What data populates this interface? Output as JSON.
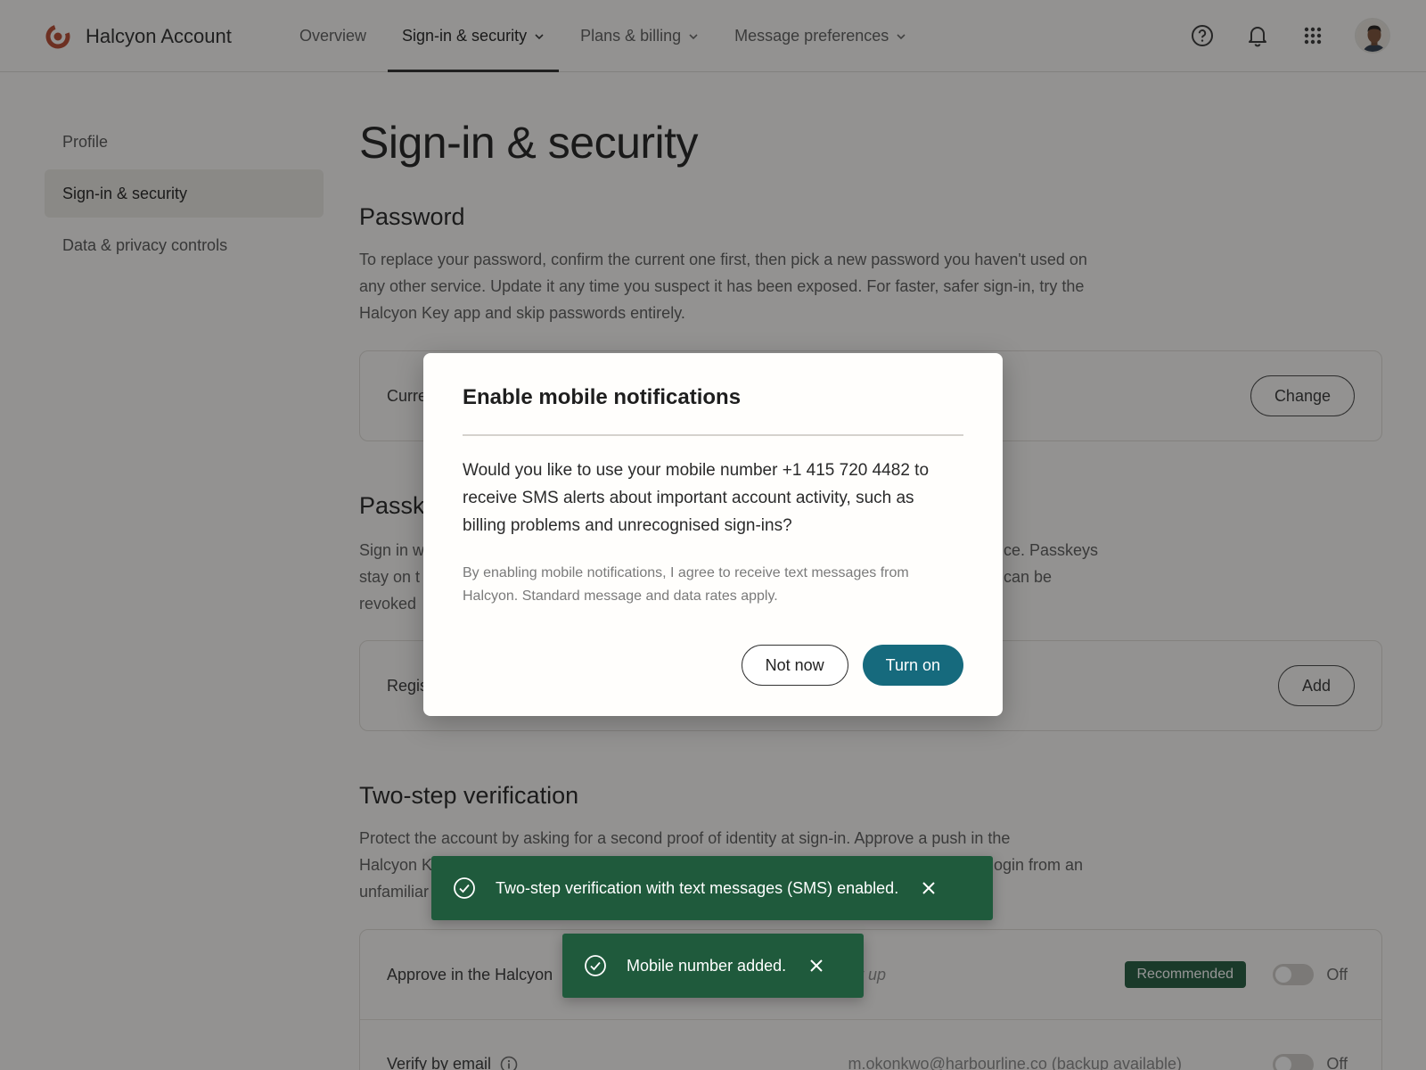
{
  "app": {
    "name": "Halcyon Account"
  },
  "nav": {
    "items": [
      {
        "label": "Overview",
        "active": false,
        "dropdown": false
      },
      {
        "label": "Sign-in & security",
        "active": true,
        "dropdown": true
      },
      {
        "label": "Plans & billing",
        "active": false,
        "dropdown": true
      },
      {
        "label": "Message preferences",
        "active": false,
        "dropdown": true
      }
    ]
  },
  "top_icons": [
    "help-icon",
    "bell-icon",
    "apps-grid-icon",
    "avatar"
  ],
  "sidebar": {
    "items": [
      {
        "label": "Profile",
        "active": false
      },
      {
        "label": "Sign-in & security",
        "active": true
      },
      {
        "label": "Data & privacy controls",
        "active": false
      }
    ]
  },
  "page": {
    "title": "Sign-in & security"
  },
  "password": {
    "title": "Password",
    "description": "To replace your password, confirm the current one first, then pick a new password you haven't used on any other service. Update it any time you suspect it has been exposed. For faster, safer sign-in, try the Halcyon Key app and skip passwords entirely.",
    "row_label": "Curre",
    "button": "Change"
  },
  "passkeys": {
    "title": "Passke",
    "desc_line1_left": "Sign in w",
    "desc_line1_right": "ce. Passkeys",
    "desc_line2_left": "stay on t",
    "desc_line2_right": "can be",
    "desc_line3_left": "revoked",
    "row_label": "Regis",
    "button": "Add"
  },
  "two_step": {
    "title": "Two-step verification",
    "desc_line1": "Protect the account by asking for a second proof of identity at sign-in. Approve a push in the",
    "desc_line2_left": "Halcyon K",
    "desc_line2_right": "ogin from an",
    "desc_line3_left": "unfamiliar",
    "rows": [
      {
        "label": "Approve in the Halcyon",
        "status": "et up",
        "badge": "Recommended",
        "toggle": "Off"
      },
      {
        "label": "Verify by email",
        "detail": "m.okonkwo@harbourline.co (backup available)",
        "toggle": "Off"
      }
    ]
  },
  "modal": {
    "title": "Enable mobile notifications",
    "body": "Would you like to use your mobile number +1 415 720 4482 to receive SMS alerts about important account activity, such as billing problems and unrecognised sign-ins?",
    "note": "By enabling mobile notifications, I agree to receive text messages from Halcyon. Standard message and data rates apply.",
    "secondary": "Not now",
    "primary": "Turn on"
  },
  "toasts": [
    {
      "message": "Two-step verification with text messages (SMS) enabled."
    },
    {
      "message": "Mobile number added."
    }
  ],
  "colors": {
    "accent": "#166a7d",
    "success": "#1f5a3c",
    "brand": "#b6472f"
  }
}
